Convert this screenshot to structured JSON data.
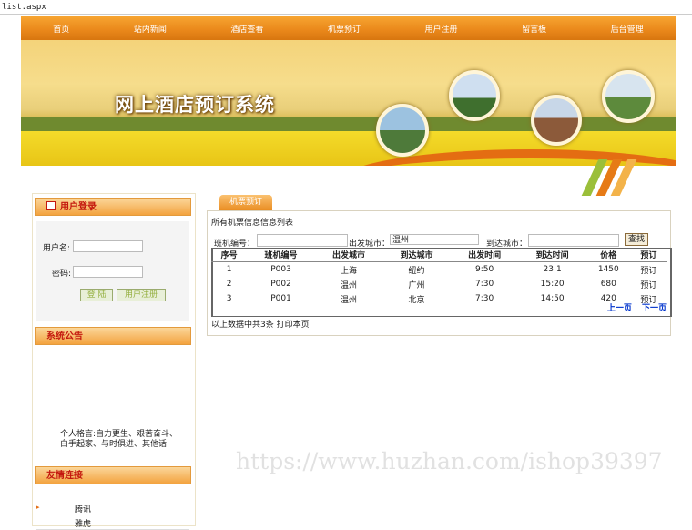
{
  "url": "list.aspx",
  "nav": [
    "首页",
    "站内新闻",
    "酒店查看",
    "机票预订",
    "用户注册",
    "留言板",
    "后台管理"
  ],
  "banner_title": "网上酒店预订系统",
  "login": {
    "heading": "用户登录",
    "username_label": "用户名:",
    "password_label": "密码:",
    "login_button": "登  陆",
    "register_button": "用户注册"
  },
  "notice": {
    "heading": "系统公告",
    "text": "个人格言:自力更生、艰苦奋斗、白手起家、与时俱进、其他话"
  },
  "links": {
    "heading": "友情连接",
    "items": [
      "腾讯",
      "雅虎"
    ]
  },
  "tab": "机票预订",
  "panel": {
    "title": "所有机票信息信息列表",
    "flight_no_label": "班机编号：",
    "from_label": "出发城市：",
    "from_value": "温州",
    "to_label": "到达城市：",
    "search_button": "查找"
  },
  "table": {
    "headers": [
      "序号",
      "班机编号",
      "出发城市",
      "到达城市",
      "出发时间",
      "到达时间",
      "价格",
      "预订"
    ],
    "rows": [
      [
        "1",
        "P003",
        "上海",
        "纽约",
        "9:50",
        "23:1",
        "1450",
        "预订"
      ],
      [
        "2",
        "P002",
        "温州",
        "广州",
        "7:30",
        "15:20",
        "680",
        "预订"
      ],
      [
        "3",
        "P001",
        "温州",
        "北京",
        "7:30",
        "14:50",
        "420",
        "预订"
      ]
    ]
  },
  "pager": {
    "prev": "上一页",
    "next": "下一页"
  },
  "footer": "以上数据中共3条  打印本页",
  "watermark": "https://www.huzhan.com/ishop39397",
  "colors": {
    "accent": "#ea8d23",
    "heading_red": "#c4180e",
    "link_blue": "#0033cc"
  }
}
